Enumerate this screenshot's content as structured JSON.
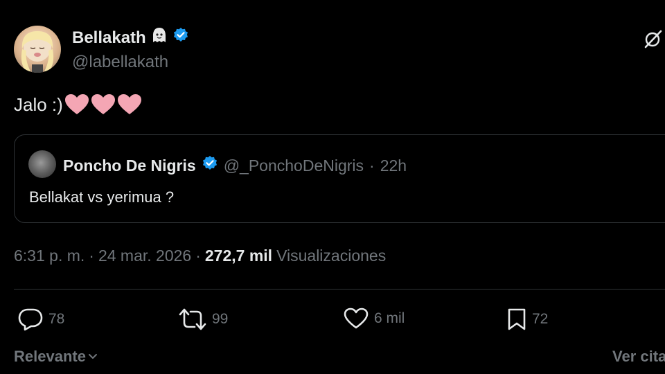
{
  "author": {
    "display_name": "Bellakath",
    "handle": "@labellakath",
    "verified": true
  },
  "tweet": {
    "text": "Jalo :)",
    "hearts": [
      "pink-heart",
      "pink-heart",
      "pink-heart"
    ]
  },
  "quote": {
    "display_name": "Poncho De Nigris",
    "handle": "@_PonchoDeNigris",
    "separator": "·",
    "time": "22h",
    "text": "Bellakat vs yerimua  ?"
  },
  "meta": {
    "time": "6:31 p. m.",
    "sep1": "·",
    "date": "24 mar. 2026",
    "sep2": "·",
    "views_count": "272,7 mil",
    "views_label": "Visualizaciones"
  },
  "actions": {
    "replies": "78",
    "reposts": "99",
    "likes": "6 mil",
    "bookmarks": "72"
  },
  "footer": {
    "sort_label": "Relevante",
    "quotes_link": "Ver cita"
  },
  "colors": {
    "background": "#000000",
    "text": "#e7e9ea",
    "muted": "#71767b",
    "border": "#2f3336",
    "verified": "#1d9bf0",
    "heart": "#f4a6b4"
  },
  "icons": [
    "verified-badge-icon",
    "ghost-emoji-icon",
    "grok-icon",
    "reply-icon",
    "repost-icon",
    "like-icon",
    "bookmark-icon",
    "chevron-down-icon"
  ]
}
